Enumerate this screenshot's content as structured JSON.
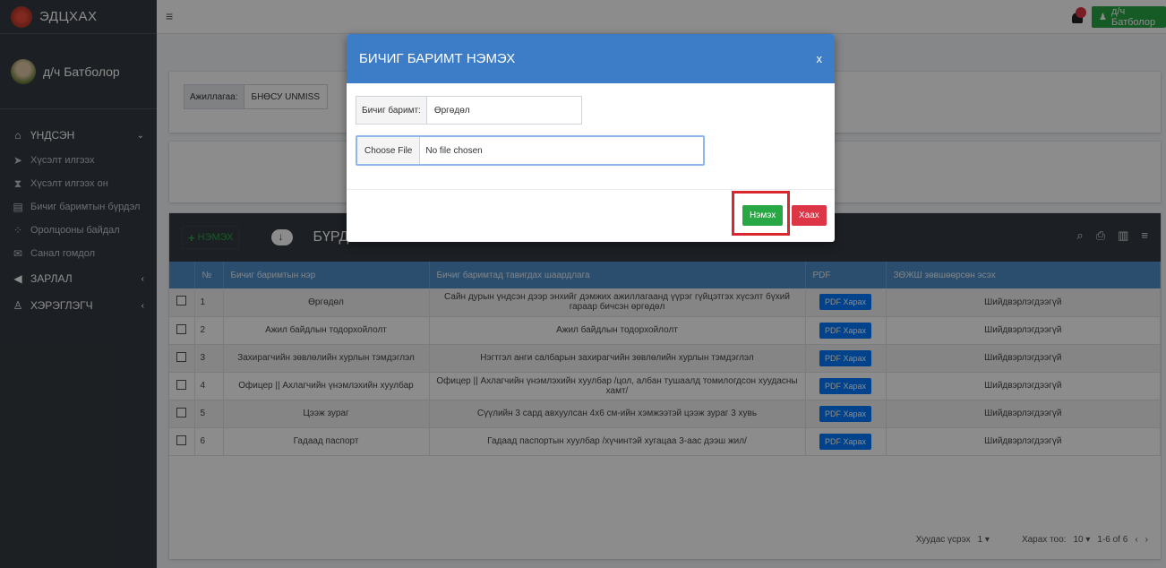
{
  "brand": {
    "name": "ЭДЦХАХ"
  },
  "user": {
    "name": "д/ч  Батболор",
    "button_label": "д/ч  Батболор"
  },
  "sidebar": {
    "items": [
      {
        "label": "ҮНДСЭН",
        "icon": "home-icon",
        "type": "section"
      },
      {
        "label": "Хүсэлт илгээх",
        "icon": "send-icon",
        "type": "sub"
      },
      {
        "label": "Хүсэлт илгээх он",
        "icon": "hourglass-icon",
        "type": "sub"
      },
      {
        "label": "Бичиг баримтын бүрдэл",
        "icon": "file-icon",
        "type": "sub"
      },
      {
        "label": "Оролцооны байдал",
        "icon": "spinner-icon",
        "type": "sub"
      },
      {
        "label": "Санал гомдол",
        "icon": "envelope-icon",
        "type": "sub"
      },
      {
        "label": "ЗАРЛАЛ",
        "icon": "megaphone-icon",
        "type": "section"
      },
      {
        "label": "ХЭРЭГЛЭГЧ",
        "icon": "user-icon",
        "type": "section"
      }
    ]
  },
  "filter": {
    "label": "Ажиллагаа:",
    "value": "БНӨСУ UNMISS"
  },
  "table": {
    "add_label": "НЭМЭХ",
    "title": "БҮРДҮҮЛСЭН БИЧИГ БАРИМТ",
    "columns": [
      "№",
      "Бичиг баримтын нэр",
      "Бичиг баримтад тавигдах шаардлага",
      "PDF",
      "ЗӨЖШ зөвшөөрсөн эсэх"
    ],
    "pdf_label": "PDF Харах",
    "rows": [
      {
        "num": "1",
        "name": "Өргөдөл",
        "req": "Сайн дурын үндсэн дээр энхийг дэмжих ажиллагаанд үүрэг гүйцэтгэх хүсэлт бүхий гараар бичсэн өргөдөл",
        "status": "Шийдвэрлэгдээгүй"
      },
      {
        "num": "2",
        "name": "Ажил байдлын тодорхойлолт",
        "req": "Ажил байдлын тодорхойлолт",
        "status": "Шийдвэрлэгдээгүй"
      },
      {
        "num": "3",
        "name": "Захирагчийн зөвлөлийн хурлын тэмдэглэл",
        "req": "Нэгтгэл анги салбарын захирагчийн зөвлөлийн хурлын тэмдэглэл",
        "status": "Шийдвэрлэгдээгүй"
      },
      {
        "num": "4",
        "name": "Офицер || Ахлагчийн үнэмлэхийн хуулбар",
        "req": "Офицер || Ахлагчийн үнэмлэхийн хуулбар /цол, албан тушаалд томилогдсон хуудасны хамт/",
        "status": "Шийдвэрлэгдээгүй"
      },
      {
        "num": "5",
        "name": "Цээж зураг",
        "req": "Сүүлийн 3 сард авхуулсан 4х6 см-ийн хэмжээтэй цээж зураг 3 хувь",
        "status": "Шийдвэрлэгдээгүй"
      },
      {
        "num": "6",
        "name": "Гадаад паспорт",
        "req": "Гадаад паспортын хуулбар /хүчинтэй хугацаа 3-аас дээш жил/",
        "status": "Шийдвэрлэгдээгүй"
      }
    ],
    "footer": {
      "page_label": "Хуудас үсрэх",
      "page_value": "1 ▾",
      "show_label": "Харах тоо:",
      "show_value": "10 ▾",
      "range": "1-6 of 6"
    }
  },
  "modal": {
    "title": "БИЧИГ БАРИМТ НЭМЭХ",
    "close": "x",
    "doc_label": "Бичиг баримт:",
    "doc_value": "Өргөдөл",
    "file_button": "Choose File",
    "file_value": "No file chosen",
    "add_button": "Нэмэх",
    "close_button": "Хаах"
  }
}
